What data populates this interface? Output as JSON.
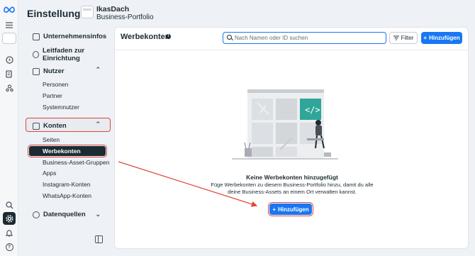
{
  "header": {
    "title": "Einstellungen",
    "portfolio_name": "IkasDach",
    "portfolio_type": "Business-Portfolio"
  },
  "sidebar": {
    "top_items": [
      {
        "label": "Unternehmensinfos",
        "icon": "company-icon"
      },
      {
        "label": "Leitfaden zur Einrichtung",
        "icon": "question-icon"
      }
    ],
    "sections": {
      "nutzer": {
        "label": "Nutzer",
        "items": [
          "Personen",
          "Partner",
          "Systemnutzer"
        ]
      },
      "konten": {
        "label": "Konten",
        "items": [
          "Seiten",
          "Werbekonten",
          "Business-Asset-Gruppen",
          "Apps",
          "Instagram-Konten",
          "WhatsApp-Konten"
        ]
      },
      "datenquellen": {
        "label": "Datenquellen"
      }
    },
    "selected_item": "Werbekonten"
  },
  "main": {
    "title": "Werbekonten",
    "search_placeholder": "Nach Namen oder ID suchen",
    "filter_label": "Filter",
    "add_label": "Hinzufügen",
    "empty_title": "Keine Werbekonten hinzugefügt",
    "empty_desc": "Füge Werbekonten zu diesem Business-Portfolio hinzu, damit du alle deine Business-Assets an einem Ort verwalten kannst.",
    "empty_add_label": "Hinzufügen"
  },
  "colors": {
    "accent": "#1877f2",
    "highlight": "#e0463c",
    "dark": "#1c2b33"
  }
}
